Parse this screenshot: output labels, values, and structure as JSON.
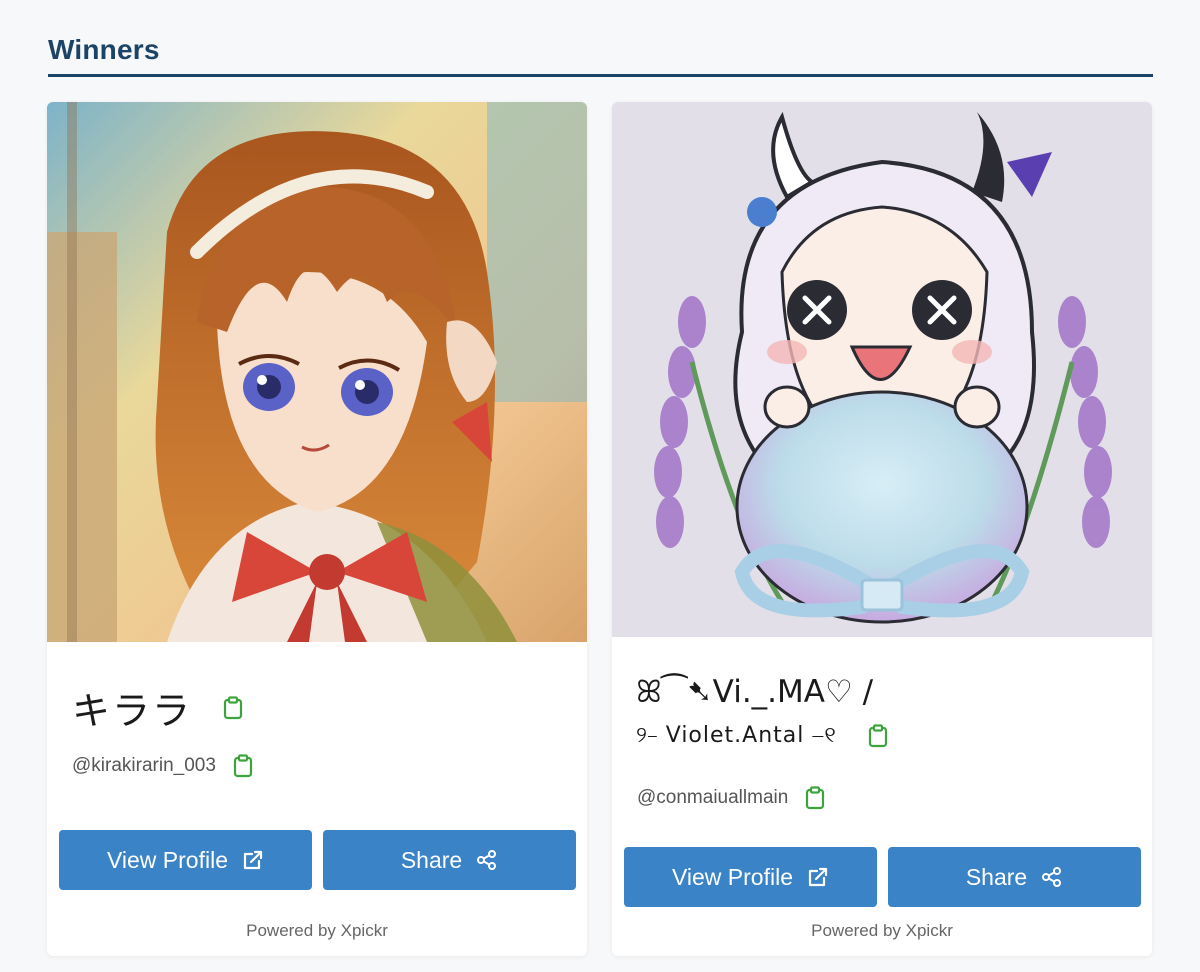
{
  "section": {
    "title": "Winners"
  },
  "colors": {
    "title": "#1c4466",
    "button": "#3a83c6",
    "clipboard_icon": "#3da33d",
    "background": "#f7f8f9"
  },
  "winners": [
    {
      "display_name": "キララ",
      "handle": "@kirakirarin_003",
      "avatar_icon": "anime-girl-brown-hair-avatar",
      "view_profile_label": "View Profile",
      "share_label": "Share",
      "powered_by": "Powered by Xpickr"
    },
    {
      "display_name_line1": "ꕤ⁀➷Vi._.MA♡ /",
      "display_name_line2": "୨⎯ Violet.Antal ⎯୧",
      "handle": "@conmaiuallmain",
      "avatar_icon": "chibi-lavender-girl-avatar",
      "view_profile_label": "View Profile",
      "share_label": "Share",
      "powered_by": "Powered by Xpickr"
    }
  ],
  "icons": {
    "copy": "clipboard-icon",
    "external": "external-link-icon",
    "share": "share-icon"
  }
}
